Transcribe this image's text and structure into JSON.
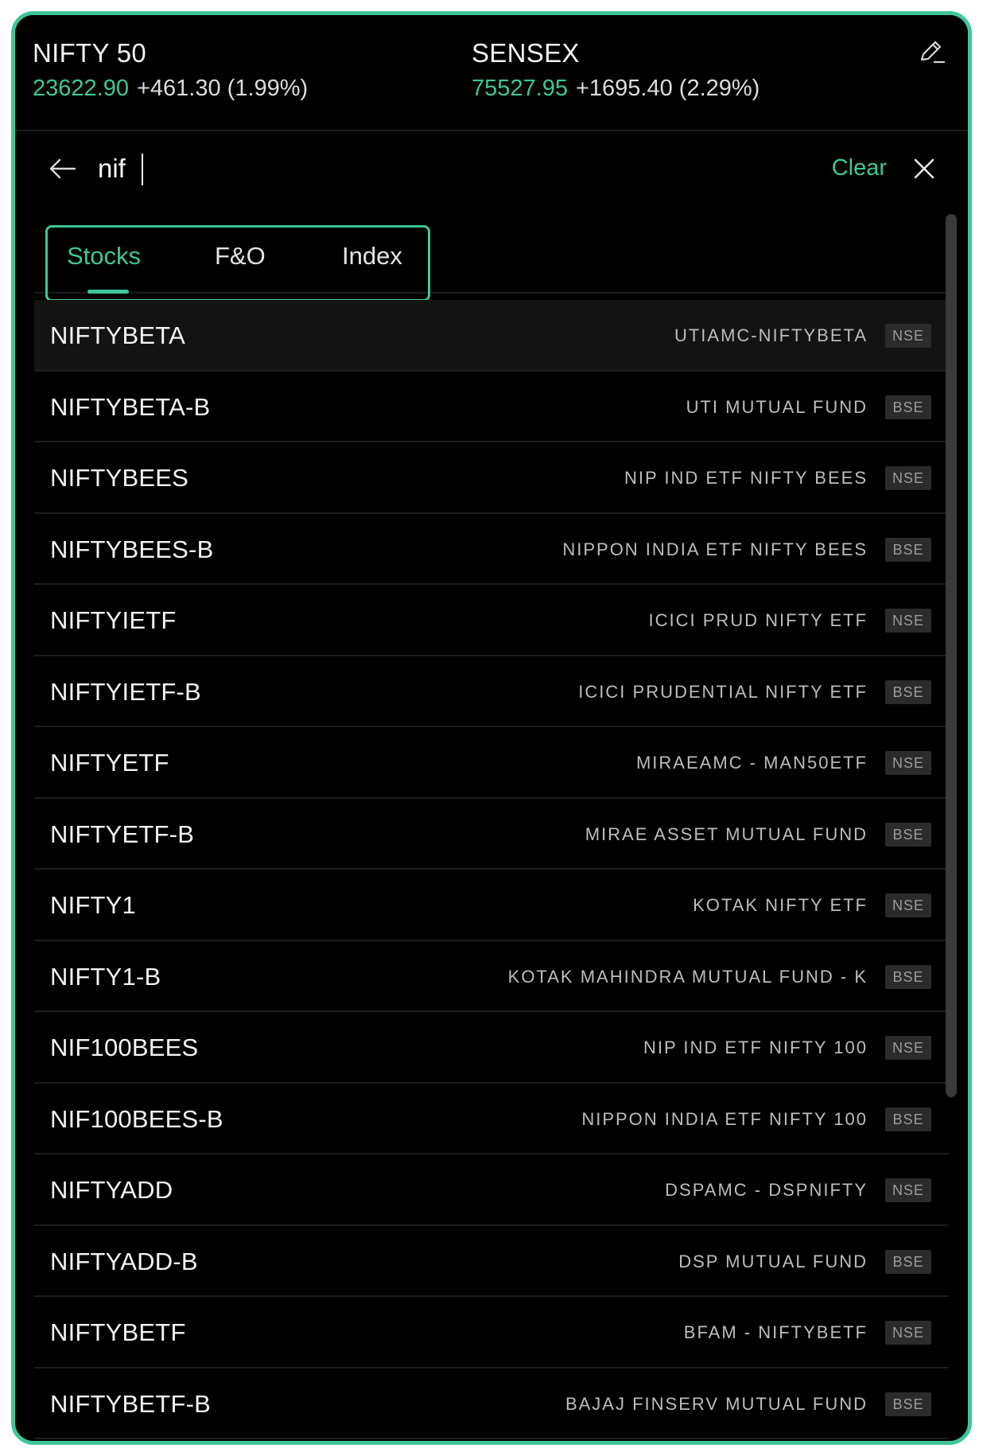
{
  "tickers": [
    {
      "name": "NIFTY 50",
      "price": "23622.90",
      "change": "+461.30 (1.99%)"
    },
    {
      "name": "SENSEX",
      "price": "75527.95",
      "change": "+1695.40 (2.29%)"
    }
  ],
  "icons": {
    "edit": "pencil-icon",
    "back": "arrow-left-icon",
    "close": "close-icon"
  },
  "search": {
    "value": "nif",
    "clear_label": "Clear"
  },
  "tabs": [
    {
      "label": "Stocks",
      "active": true
    },
    {
      "label": "F&O",
      "active": false
    },
    {
      "label": "Index",
      "active": false
    }
  ],
  "results": [
    {
      "symbol": "NIFTYBETA",
      "company": "UTIAMC-NIFTYBETA",
      "exchange": "NSE"
    },
    {
      "symbol": "NIFTYBETA-B",
      "company": "UTI MUTUAL FUND",
      "exchange": "BSE"
    },
    {
      "symbol": "NIFTYBEES",
      "company": "NIP IND ETF NIFTY BEES",
      "exchange": "NSE"
    },
    {
      "symbol": "NIFTYBEES-B",
      "company": "NIPPON INDIA ETF NIFTY BEES",
      "exchange": "BSE"
    },
    {
      "symbol": "NIFTYIETF",
      "company": "ICICI PRUD NIFTY ETF",
      "exchange": "NSE"
    },
    {
      "symbol": "NIFTYIETF-B",
      "company": "ICICI PRUDENTIAL NIFTY ETF",
      "exchange": "BSE"
    },
    {
      "symbol": "NIFTYETF",
      "company": "MIRAEAMC - MAN50ETF",
      "exchange": "NSE"
    },
    {
      "symbol": "NIFTYETF-B",
      "company": "MIRAE ASSET MUTUAL FUND",
      "exchange": "BSE"
    },
    {
      "symbol": "NIFTY1",
      "company": "KOTAK NIFTY ETF",
      "exchange": "NSE"
    },
    {
      "symbol": "NIFTY1-B",
      "company": "KOTAK MAHINDRA MUTUAL FUND - K",
      "exchange": "BSE"
    },
    {
      "symbol": "NIF100BEES",
      "company": "NIP IND ETF NIFTY 100",
      "exchange": "NSE"
    },
    {
      "symbol": "NIF100BEES-B",
      "company": "NIPPON INDIA ETF NIFTY 100",
      "exchange": "BSE"
    },
    {
      "symbol": "NIFTYADD",
      "company": "DSPAMC - DSPNIFTY",
      "exchange": "NSE"
    },
    {
      "symbol": "NIFTYADD-B",
      "company": "DSP MUTUAL FUND",
      "exchange": "BSE"
    },
    {
      "symbol": "NIFTYBETF",
      "company": "BFAM - NIFTYBETF",
      "exchange": "NSE"
    },
    {
      "symbol": "NIFTYBETF-B",
      "company": "BAJAJ FINSERV MUTUAL FUND",
      "exchange": "BSE"
    }
  ],
  "colors": {
    "accent": "#3ec69a",
    "background": "#000000",
    "text": "#f4f4f4",
    "muted": "#bdbdbd",
    "badge_bg": "#2b2b2b"
  }
}
